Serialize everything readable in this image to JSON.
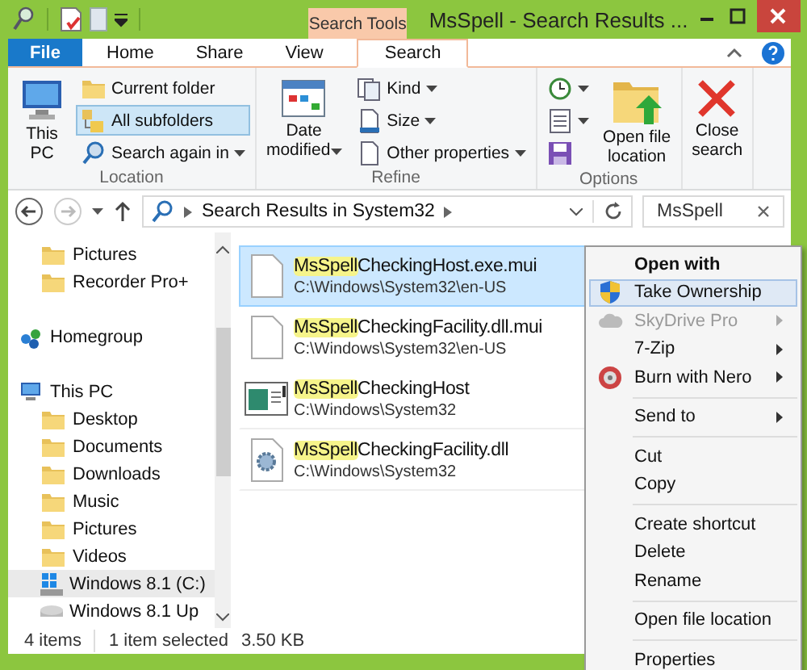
{
  "window": {
    "title": "MsSpell - Search Results ...",
    "contextual_tab": "Search Tools"
  },
  "ribbon_tabs": [
    {
      "label": "File",
      "kind": "file",
      "selected": false
    },
    {
      "label": "Home",
      "kind": "tab",
      "selected": false
    },
    {
      "label": "Share",
      "kind": "tab",
      "selected": false
    },
    {
      "label": "View",
      "kind": "tab",
      "selected": false
    },
    {
      "label": "Search",
      "kind": "tab",
      "selected": true
    }
  ],
  "ribbon_groups": [
    {
      "label": "Location",
      "columns": [
        {
          "kind": "large",
          "label": "This\nPC",
          "dropdown": false
        },
        {
          "kind": "small",
          "items": [
            {
              "label": "Current folder",
              "selected": false,
              "dropdown": false
            },
            {
              "label": "All subfolders",
              "selected": true,
              "dropdown": false
            },
            {
              "label": "Search again in",
              "selected": false,
              "dropdown": true
            }
          ]
        }
      ]
    },
    {
      "label": "Refine",
      "columns": [
        {
          "kind": "large",
          "label": "Date\nmodified",
          "dropdown": true
        },
        {
          "kind": "small",
          "items": [
            {
              "label": "Kind",
              "selected": false,
              "dropdown": true
            },
            {
              "label": "Size",
              "selected": false,
              "dropdown": true
            },
            {
              "label": "Other properties",
              "selected": false,
              "dropdown": true
            }
          ]
        }
      ]
    },
    {
      "label": "Options",
      "columns": [
        {
          "kind": "small",
          "items": [
            {
              "selected": false,
              "dropdown": true
            },
            {
              "selected": false,
              "dropdown": true
            },
            {
              "selected": false,
              "dropdown": false
            }
          ]
        },
        {
          "kind": "large",
          "label": "Open file\nlocation",
          "dropdown": false
        }
      ]
    },
    {
      "columns": [
        {
          "kind": "large",
          "label": "Close\nsearch",
          "dropdown": false
        }
      ]
    }
  ],
  "address": {
    "location": "Search Results in System32",
    "search": "MsSpell"
  },
  "nav": [
    {
      "children": [
        {
          "label": "Pictures",
          "selected": false
        },
        {
          "label": "Recorder Pro+",
          "selected": false
        }
      ]
    },
    {
      "label": "Homegroup",
      "selected": false
    },
    {
      "label": "This PC",
      "selected": false,
      "children": [
        {
          "label": "Desktop",
          "selected": false
        },
        {
          "label": "Documents",
          "selected": false
        },
        {
          "label": "Downloads",
          "selected": false
        },
        {
          "label": "Music",
          "selected": false
        },
        {
          "label": "Pictures",
          "selected": false
        },
        {
          "label": "Videos",
          "selected": false
        },
        {
          "label": "Windows 8.1 (C:)",
          "selected": true
        },
        {
          "label": "Windows 8.1 Up",
          "selected": false
        }
      ]
    }
  ],
  "results": [
    {
      "match": "MsSpell",
      "rest": "CheckingHost.exe.mui",
      "path": "C:\\Windows\\System32\\en-US",
      "selected": true
    },
    {
      "match": "MsSpell",
      "rest": "CheckingFacility.dll.mui",
      "path": "C:\\Windows\\System32\\en-US",
      "selected": false
    },
    {
      "match": "MsSpell",
      "rest": "CheckingHost",
      "path": "C:\\Windows\\System32",
      "selected": false
    },
    {
      "match": "MsSpell",
      "rest": "CheckingFacility.dll",
      "path": "C:\\Windows\\System32",
      "selected": false
    }
  ],
  "context_menu": [
    {
      "kind": "item",
      "label": "Open with",
      "bold": true,
      "selected": false,
      "disabled": false,
      "submenu": false
    },
    {
      "kind": "item",
      "label": "Take Ownership",
      "bold": false,
      "selected": true,
      "disabled": false,
      "submenu": false
    },
    {
      "kind": "item",
      "label": "SkyDrive Pro",
      "bold": false,
      "selected": false,
      "disabled": true,
      "submenu": true
    },
    {
      "kind": "item",
      "label": "7-Zip",
      "bold": false,
      "selected": false,
      "disabled": false,
      "submenu": true
    },
    {
      "kind": "item",
      "label": "Burn with Nero",
      "bold": false,
      "selected": false,
      "disabled": false,
      "submenu": true
    },
    {
      "kind": "separator"
    },
    {
      "kind": "item",
      "label": "Send to",
      "bold": false,
      "selected": false,
      "disabled": false,
      "submenu": true
    },
    {
      "kind": "separator"
    },
    {
      "kind": "item",
      "label": "Cut",
      "bold": false,
      "selected": false,
      "disabled": false,
      "submenu": false
    },
    {
      "kind": "item",
      "label": "Copy",
      "bold": false,
      "selected": false,
      "disabled": false,
      "submenu": false
    },
    {
      "kind": "separator"
    },
    {
      "kind": "item",
      "label": "Create shortcut",
      "bold": false,
      "selected": false,
      "disabled": false,
      "submenu": false
    },
    {
      "kind": "item",
      "label": "Delete",
      "bold": false,
      "selected": false,
      "disabled": false,
      "submenu": false
    },
    {
      "kind": "item",
      "label": "Rename",
      "bold": false,
      "selected": false,
      "disabled": false,
      "submenu": false
    },
    {
      "kind": "separator"
    },
    {
      "kind": "item",
      "label": "Open file location",
      "bold": false,
      "selected": false,
      "disabled": false,
      "submenu": false
    },
    {
      "kind": "separator"
    },
    {
      "kind": "item",
      "label": "Properties",
      "bold": false,
      "selected": false,
      "disabled": false,
      "submenu": false
    }
  ],
  "status_bar": {
    "count": "4 items",
    "selection": "1 item selected",
    "size": "3.50 KB"
  }
}
